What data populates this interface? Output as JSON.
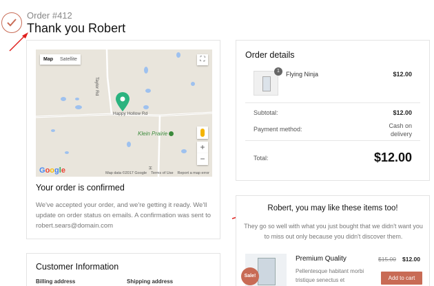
{
  "header": {
    "order_number": "Order #412",
    "title": "Thank you Robert"
  },
  "map": {
    "view_map": "Map",
    "view_satellite": "Satellite",
    "road_taylor": "Taylor Rd",
    "road_happy_hollow": "Happy Hollow Rd",
    "road_h": "H",
    "park": "Klein Prairie",
    "footer": {
      "data": "Map data ©2017 Google",
      "terms": "Terms of Use",
      "report": "Report a map error"
    },
    "google_logo": [
      "G",
      "o",
      "o",
      "g",
      "l",
      "e"
    ]
  },
  "confirmation": {
    "title": "Your order is confirmed",
    "body": "We've accepted your order, and we're getting it ready. We'll update on order status on emails. A confirmation was sent to robert.sears@domain.com"
  },
  "customer_info": {
    "title": "Customer Information",
    "billing_label": "Billing address",
    "shipping_label": "Shipping address"
  },
  "order_details": {
    "title": "Order details",
    "item": {
      "name": "Flying Ninja",
      "qty": "1",
      "price": "$12.00"
    },
    "subtotal_label": "Subtotal:",
    "subtotal_value": "$12.00",
    "payment_label": "Payment method:",
    "payment_value": "Cash on delivery",
    "total_label": "Total:",
    "total_value": "$12.00"
  },
  "recommendations": {
    "title": "Robert, you may like these items too!",
    "subtitle": "They go so well with what you just bought that we didn't want you to miss out only because you didn't discover them.",
    "product": {
      "name": "Premium Quality",
      "description": "Pellentesque habitant morbi tristique senectus et",
      "old_price": "$15.00",
      "new_price": "$12.00",
      "sale_badge": "Sale!",
      "cta": "Add to cart"
    }
  },
  "colors": {
    "accent": "#c86b55",
    "annotation_arrow": "#e0201e",
    "map_pin": "#2bb37f",
    "park_green": "#3b8a3b"
  }
}
